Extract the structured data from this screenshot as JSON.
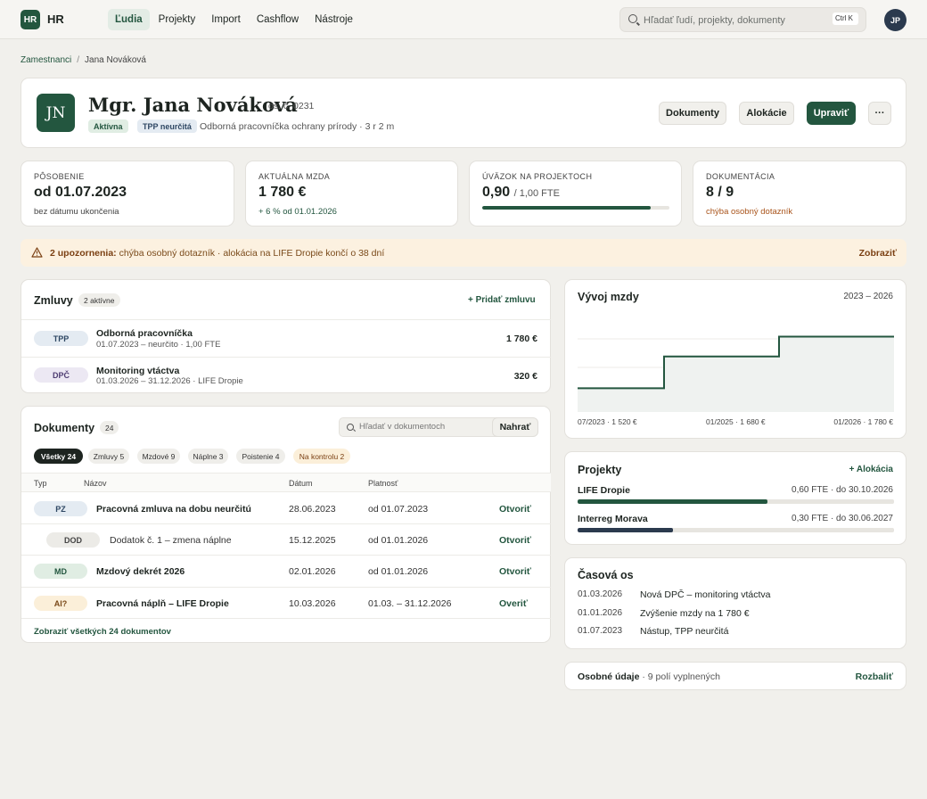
{
  "app": {
    "logo": "HR",
    "name": "HR"
  },
  "nav": [
    "Ľudia",
    "Projekty",
    "Import",
    "Cashflow",
    "Nástroje"
  ],
  "search": {
    "placeholder": "Hľadať ľudí, projekty, dokumenty",
    "shortcut": "Ctrl K"
  },
  "user": {
    "initials": "JP"
  },
  "breadcrumb": {
    "parent": "Zamestnanci",
    "current": "Jana Nováková"
  },
  "profile": {
    "initials": "JN",
    "name": "Mgr. Jana Nováková",
    "number": "os. č. 0231",
    "status": "Aktívna",
    "contract": "TPP neurčitá",
    "role": "Odborná pracovníčka ochrany prírody · 3 r 2 m",
    "buttons": {
      "documents": "Dokumenty",
      "allocations": "Alokácie",
      "edit": "Upraviť",
      "more": "···"
    }
  },
  "stats": [
    {
      "label": "PÔSOBENIE",
      "value": "od 01.07.2023",
      "sub": "bez dátumu ukončenia"
    },
    {
      "label": "AKTUÁLNA MZDA",
      "value": "1 780 €",
      "sub": "+ 6 % od 01.01.2026"
    },
    {
      "label": "ÚVÄZOK NA PROJEKTOCH",
      "value": "0,90",
      "value_sub": "/ 1,00 FTE",
      "progress": 0.9
    },
    {
      "label": "DOKUMENTÁCIA",
      "value": "8 / 9",
      "sub": "chýba osobný dotazník"
    }
  ],
  "warning": {
    "lead": "2 upozornenia:",
    "text": " chýba osobný dotazník · alokácia na LIFE Dropie končí o 38 dní",
    "action": "Zobraziť"
  },
  "contracts": {
    "title": "Zmluvy",
    "count": "2 aktívne",
    "add": "+ Pridať zmluvu",
    "items": [
      {
        "tag": "TPP",
        "title": "Odborná pracovníčka",
        "sub": "01.07.2023 – neurčito · 1,00 FTE",
        "amount": "1 780 €"
      },
      {
        "tag": "DPČ",
        "title": "Monitoring vtáctva",
        "sub": "01.03.2026 – 31.12.2026 · LIFE Dropie",
        "amount": "320 €"
      }
    ]
  },
  "documents": {
    "title": "Dokumenty",
    "count": "24",
    "search_placeholder": "Hľadať v dokumentoch",
    "upload": "Nahrať",
    "filters": [
      "Všetky 24",
      "Zmluvy 5",
      "Mzdové 9",
      "Náplne 3",
      "Poistenie 4",
      "Na kontrolu 2"
    ],
    "columns": [
      "Typ",
      "Názov",
      "Dátum",
      "Platnosť"
    ],
    "rows": [
      {
        "tag": "PZ",
        "name": "Pracovná zmluva na dobu neurčitú",
        "date": "28.06.2023",
        "validity": "od 01.07.2023",
        "action": "Otvoriť"
      },
      {
        "tag": "DOD",
        "name": "Dodatok č. 1 – zmena náplne",
        "date": "15.12.2025",
        "validity": "od 01.01.2026",
        "action": "Otvoriť"
      },
      {
        "tag": "MD",
        "name": "Mzdový dekrét 2026",
        "date": "02.01.2026",
        "validity": "od 01.01.2026",
        "action": "Otvoriť"
      },
      {
        "tag": "AI?",
        "name": "Pracovná náplň – LIFE Dropie",
        "date": "10.03.2026",
        "validity": "01.03. – 31.12.2026",
        "action": "Overiť"
      }
    ],
    "show_all": "Zobraziť všetkých 24 dokumentov"
  },
  "salary": {
    "title": "Vývoj mzdy",
    "range": "2023 – 2026",
    "chart_data": {
      "type": "area",
      "step": true,
      "x": [
        "07/2023",
        "01/2025",
        "01/2026"
      ],
      "values": [
        1520,
        1680,
        1780
      ],
      "tick_labels": [
        "07/2023 · 1 520 €",
        "01/2025 · 1 680 €",
        "01/2026 · 1 780 €"
      ],
      "ylim": [
        1400,
        1850
      ],
      "line_color": "#23563f"
    }
  },
  "projects": {
    "title": "Projekty",
    "add": "+ Alokácia",
    "items": [
      {
        "name": "LIFE Dropie",
        "value": "0,60 FTE · do 30.10.2026",
        "progress": 0.6
      },
      {
        "name": "Interreg Morava",
        "value": "0,30 FTE · do 30.06.2027",
        "progress": 0.3
      }
    ]
  },
  "timeline": {
    "title": "Časová os",
    "items": [
      {
        "date": "01.03.2026",
        "text": "Nová DPČ – monitoring vtáctva"
      },
      {
        "date": "01.01.2026",
        "text": "Zvýšenie mzdy na 1 780 €"
      },
      {
        "date": "01.07.2023",
        "text": "Nástup, TPP neurčitá"
      }
    ]
  },
  "personal": {
    "title": "Osobné údaje",
    "sub": " · 9 polí vyplnených",
    "action": "Rozbaliť"
  },
  "colors": {
    "primary": "#23563f",
    "dark": "#2b3a4e",
    "warning_bg": "#fcf1e0"
  }
}
